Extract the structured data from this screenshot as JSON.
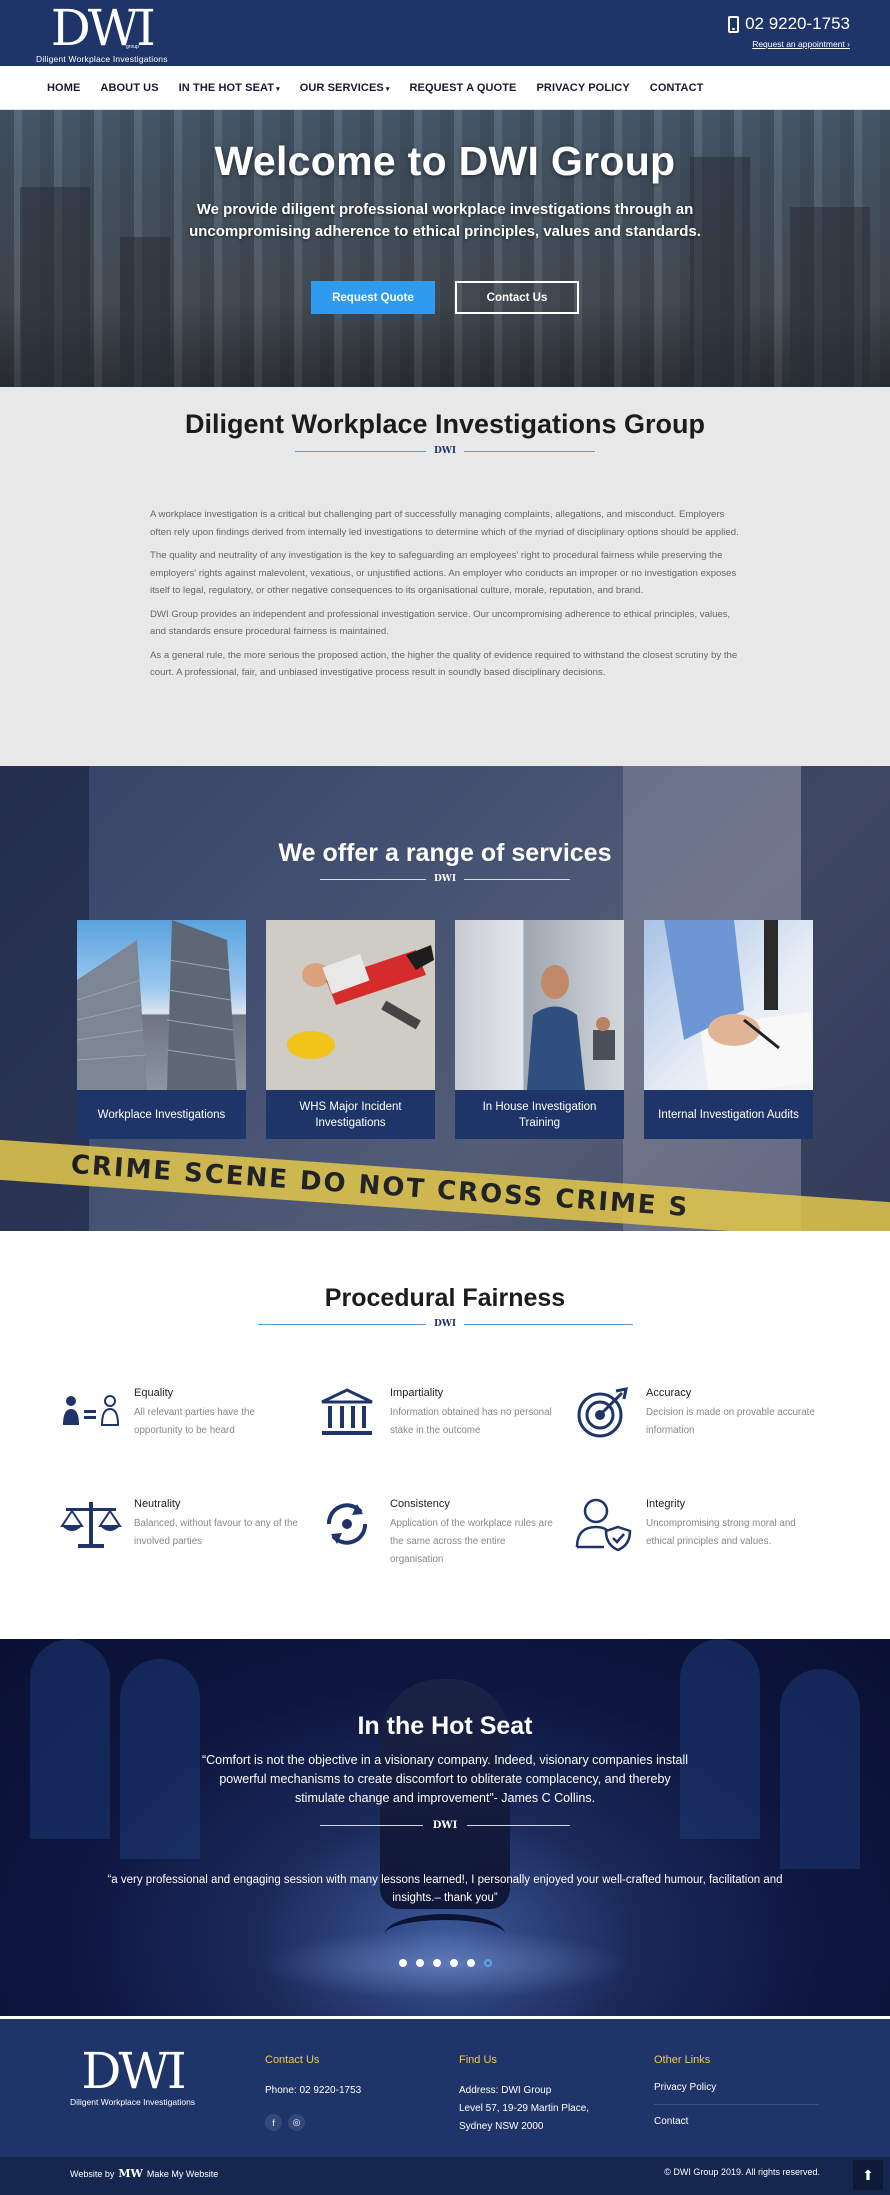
{
  "header": {
    "logo_mark": "DWI",
    "logo_tagline": "Diligent Workplace Investigations",
    "logo_group": "group",
    "phone": "02 9220-1753",
    "appointment_link": "Request an appointment ›"
  },
  "nav": {
    "items": [
      {
        "label": "HOME",
        "has_caret": false,
        "active": true
      },
      {
        "label": "ABOUT US",
        "has_caret": false
      },
      {
        "label": "IN THE HOT SEAT",
        "has_caret": true
      },
      {
        "label": "OUR SERVICES",
        "has_caret": true
      },
      {
        "label": "REQUEST A QUOTE",
        "has_caret": false
      },
      {
        "label": "PRIVACY POLICY",
        "has_caret": false
      },
      {
        "label": "CONTACT",
        "has_caret": false
      }
    ],
    "caret": "▾"
  },
  "hero": {
    "title": "Welcome to DWI Group",
    "subtitle": "We provide diligent professional workplace investigations through an uncompromising adherence to ethical principles, values and standards.",
    "primary_button": "Request Quote",
    "secondary_button": "Contact Us"
  },
  "intro": {
    "title": "Diligent Workplace Investigations Group",
    "divider_mark": "DWI",
    "paragraphs": [
      "A workplace investigation is a critical but challenging part of successfully managing complaints, allegations, and misconduct. Employers often rely upon findings derived from internally led investigations to determine which of the myriad of disciplinary options should be applied.",
      "The quality and neutrality of any investigation is the key to safeguarding an employees' right to procedural fairness while preserving the employers' rights against malevolent, vexatious, or unjustified actions.  An employer who conducts an improper or no investigation exposes itself to legal, regulatory, or other negative consequences to its organisational culture, morale, reputation, and brand.",
      "DWI Group provides an independent and professional investigation service. Our uncompromising adherence to ethical principles, values, and standards ensure procedural fairness is maintained.",
      "As a general rule, the more serious the proposed action, the higher the quality of evidence required to withstand the closest scrutiny by the court. A professional, fair, and unbiased investigative process result in soundly based disciplinary decisions."
    ]
  },
  "services": {
    "title": "We offer a range of services",
    "divider_mark": "DWI",
    "tape_text": "CRIME SCENE DO NOT CROSS          CRIME S",
    "cards": [
      {
        "label": "Workplace Investigations"
      },
      {
        "label": "WHS Major Incident Investigations"
      },
      {
        "label": "In House Investigation Training"
      },
      {
        "label": "Internal Investigation Audits"
      }
    ]
  },
  "fairness": {
    "title": "Procedural Fairness",
    "divider_mark": "DWI",
    "items": [
      {
        "title": "Equality",
        "text": "All relevant parties have the opportunity to be heard",
        "icon": "equality-icon"
      },
      {
        "title": "Impartiality",
        "text": "Information obtained has no personal stake in the outcome",
        "icon": "courthouse-icon"
      },
      {
        "title": "Accuracy",
        "text": "Decision is made on provable accurate information",
        "icon": "target-icon"
      },
      {
        "title": "Neutrality",
        "text": "Balanced, without favour to any of the involved parties",
        "icon": "scales-icon"
      },
      {
        "title": "Consistency",
        "text": "Application of the workplace rules are the same across the entire organisation",
        "icon": "cycle-icon"
      },
      {
        "title": "Integrity",
        "text": "Uncompromising strong moral and ethical principles and values.",
        "icon": "shield-user-icon"
      }
    ]
  },
  "hotseat": {
    "title": "In the Hot Seat",
    "quote": "“Comfort is not the objective in a visionary company. Indeed, visionary companies install powerful mechanisms to create discomfort to obliterate complacency, and thereby stimulate change and improvement”- James C Collins.",
    "divider_mark": "DWI",
    "testimonial": "“a very professional and engaging session with many lessons learned!, I personally enjoyed your well-crafted humour, facilitation and insights.– thank you”",
    "slide_count": 6,
    "active_slide": 6
  },
  "footer": {
    "logo_mark": "DWI",
    "logo_tagline": "Diligent Workplace Investigations",
    "contact": {
      "heading": "Contact Us",
      "phone": "Phone: 02 9220-1753",
      "social": [
        {
          "label": "f",
          "name": "facebook-icon"
        },
        {
          "label": "◎",
          "name": "instagram-icon"
        }
      ]
    },
    "find": {
      "heading": "Find Us",
      "line1": "Address: DWI Group",
      "line2": "Level 57, 19-29 Martin Place,",
      "line3": "Sydney NSW 2000"
    },
    "links": {
      "heading": "Other Links",
      "items": [
        "Privacy Policy",
        "Contact"
      ]
    },
    "accent_color": "#f2c94c"
  },
  "bottombar": {
    "credit_prefix": "Website by",
    "credit_mark": "MW",
    "credit_name": "Make My Website",
    "copyright": "© DWI Group 2019. All rights reserved.",
    "back_to_top": "⬆"
  },
  "colors": {
    "navy": "#1f3468",
    "button_blue": "#2f9bf0",
    "divider_blue": "#5a9fd0"
  }
}
